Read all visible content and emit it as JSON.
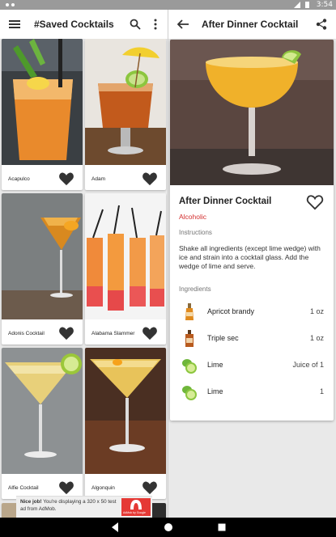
{
  "status": {
    "time": "3:54"
  },
  "left_pane": {
    "title": "#Saved Cocktails",
    "cards": [
      {
        "name": "Acapulco"
      },
      {
        "name": "Adam"
      },
      {
        "name": "Adonis Cocktail"
      },
      {
        "name": "Alabama Slammer"
      },
      {
        "name": "Alfie Cocktail"
      },
      {
        "name": "Algonquin"
      }
    ]
  },
  "right_pane": {
    "title": "After Dinner Cocktail",
    "drink_name": "After Dinner Cocktail",
    "category": "Alcoholic",
    "instructions_label": "Instructions",
    "instructions": "Shake all ingredients (except lime wedge) with ice and strain into a cocktail glass. Add the wedge of lime and serve.",
    "ingredients_label": "Ingredients",
    "ingredients": [
      {
        "name": "Apricot brandy",
        "amount": "1 oz",
        "icon": "brandy-bottle-icon"
      },
      {
        "name": "Triple sec",
        "amount": "1 oz",
        "icon": "liqueur-bottle-icon"
      },
      {
        "name": "Lime",
        "amount": "Juice of 1",
        "icon": "lime-icon"
      },
      {
        "name": "Lime",
        "amount": "1",
        "icon": "lime-icon"
      }
    ]
  },
  "ad": {
    "headline": "Nice job!",
    "text": "You're displaying a 320 x 50 test ad from AdMob.",
    "logo_label": "AdMob by Google"
  },
  "colors": {
    "accent": "#d32f2f",
    "navbar": "#000000",
    "statusbar": "#9a9a9a"
  }
}
